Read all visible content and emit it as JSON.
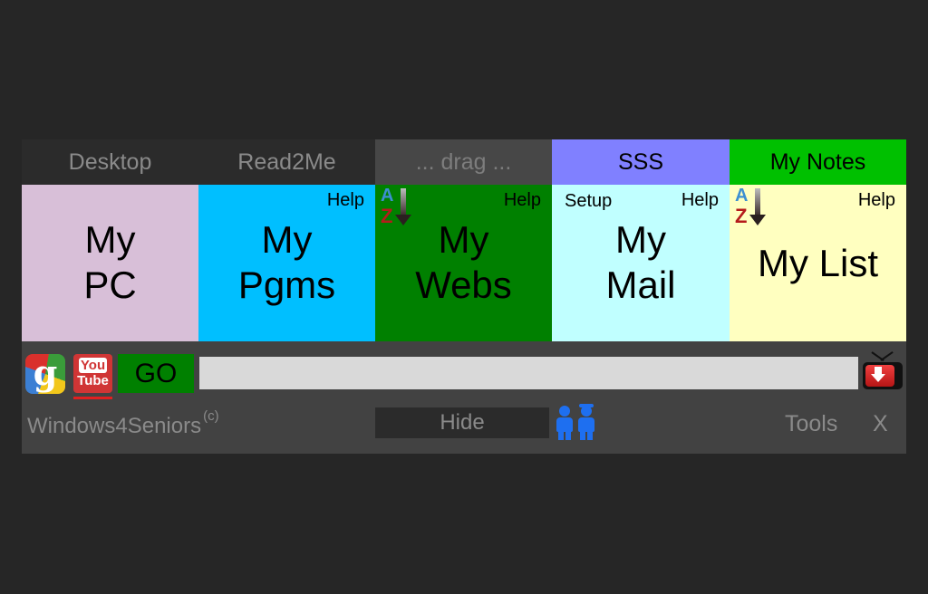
{
  "tabs": [
    {
      "label": "Desktop"
    },
    {
      "label": "Read2Me"
    },
    {
      "label": "... drag ..."
    },
    {
      "label": "SSS"
    },
    {
      "label": "My Notes"
    }
  ],
  "tiles": [
    {
      "line1": "My",
      "line2": "PC"
    },
    {
      "line1": "My",
      "line2": "Pgms",
      "help": "Help"
    },
    {
      "line1": "My",
      "line2": "Webs",
      "help": "Help",
      "sort_a": "A",
      "sort_z": "Z"
    },
    {
      "line1": "My",
      "line2": "Mail",
      "help": "Help",
      "setup": "Setup"
    },
    {
      "label": "My List",
      "help": "Help",
      "sort_a": "A",
      "sort_z": "Z"
    }
  ],
  "search": {
    "google_glyph": "g",
    "youtube_top": "You",
    "youtube_bottom": "Tube",
    "go_label": "GO",
    "url_value": ""
  },
  "footer": {
    "brand": "Windows4Seniors",
    "copyright": "(c)",
    "hide_label": "Hide",
    "tools_label": "Tools",
    "close_label": "X"
  },
  "colors": {
    "my_pc": "#d8bfd8",
    "my_pgms": "#00bfff",
    "my_webs": "#008000",
    "my_mail": "#c0ffff",
    "my_list": "#ffffc0",
    "sss": "#8080ff",
    "my_notes": "#00c000"
  }
}
